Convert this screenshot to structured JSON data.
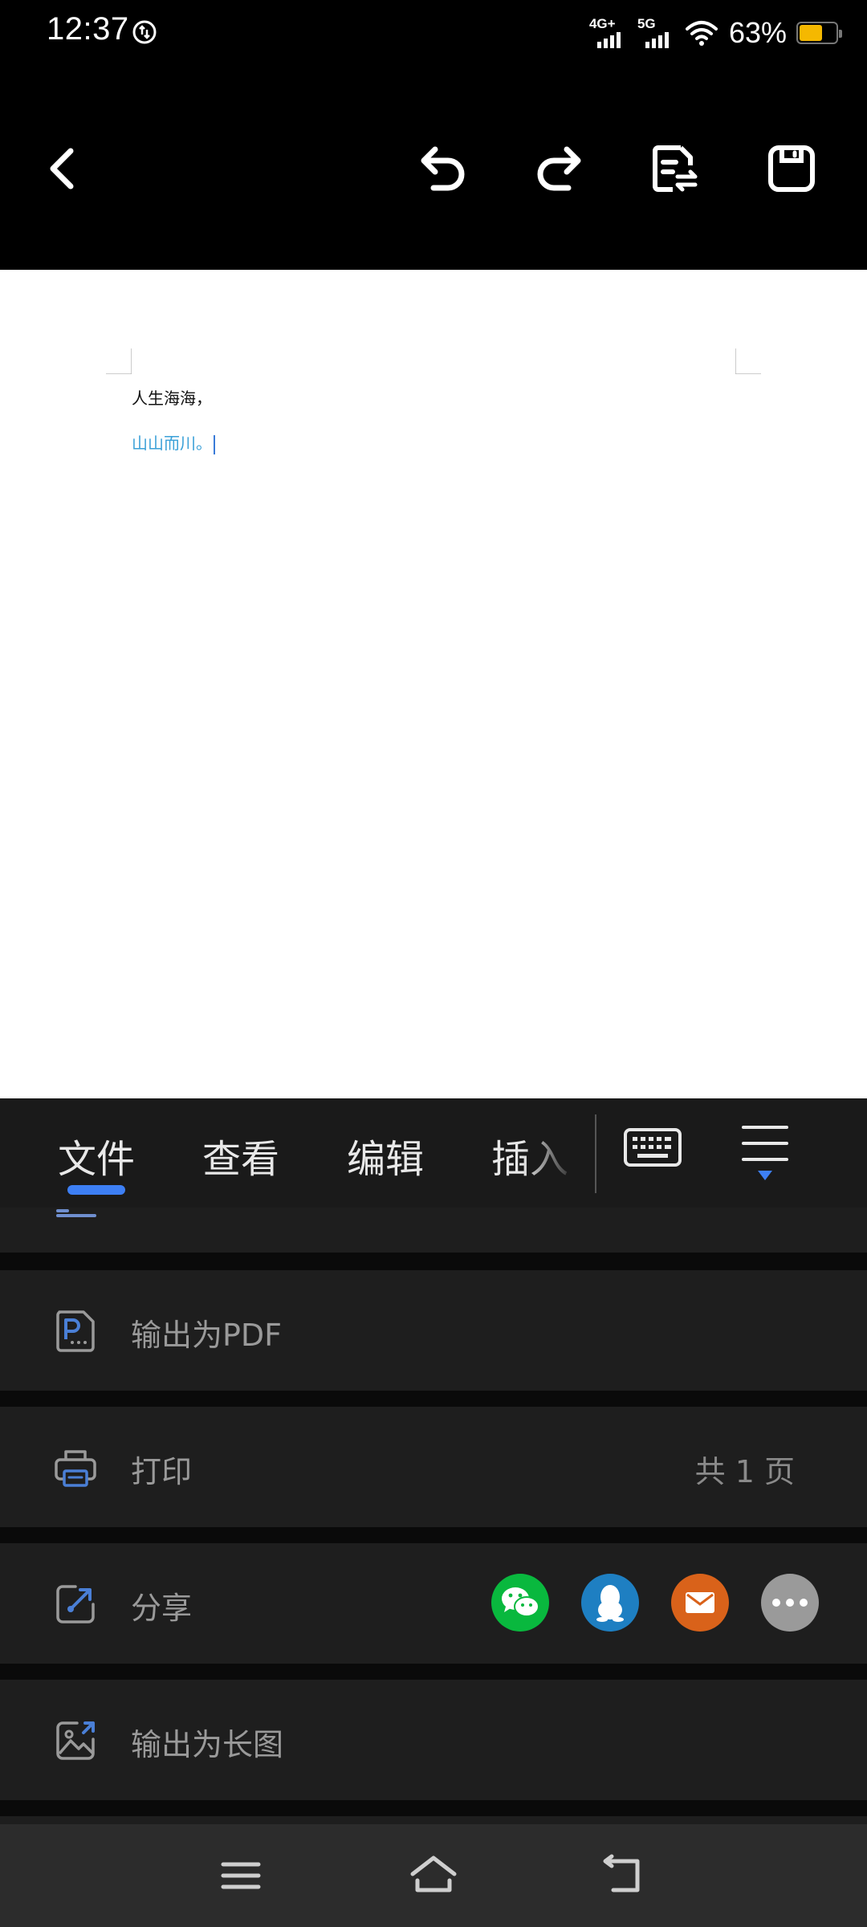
{
  "status_bar": {
    "time": "12:37",
    "network1": "4G+",
    "network2": "5G",
    "battery_percent": "63%",
    "battery_level": 0.63,
    "icons": [
      "vpn-icon",
      "signal-icon",
      "wifi-icon",
      "battery-icon"
    ]
  },
  "toolbar": {
    "icons": [
      "back-icon",
      "undo-icon",
      "redo-icon",
      "document-switch-icon",
      "save-icon"
    ]
  },
  "document": {
    "line1": "人生海海，",
    "line2": "山山而川。",
    "line2_color": "#3aa0d8"
  },
  "tabs": {
    "items": [
      {
        "label": "文件"
      },
      {
        "label": "查看"
      },
      {
        "label": "编辑"
      },
      {
        "label": "插入"
      }
    ],
    "active_index": 0,
    "accent": "#3d7ff5",
    "icons": [
      "keyboard-icon",
      "menu-icon"
    ]
  },
  "menu": {
    "items": [
      {
        "label": "输出为PDF",
        "icon": "pdf-icon"
      },
      {
        "label": "打印",
        "icon": "printer-icon",
        "right_text": "共 1 页"
      },
      {
        "label": "分享",
        "icon": "share-icon"
      },
      {
        "label": "输出为长图",
        "icon": "image-export-icon"
      }
    ],
    "share_targets": [
      {
        "name": "wechat-icon",
        "color": "#09b83e"
      },
      {
        "name": "qq-icon",
        "color": "#1e7fc2"
      },
      {
        "name": "mail-icon",
        "color": "#d9621a"
      },
      {
        "name": "more-icon",
        "color": "#9a9a9a"
      }
    ]
  },
  "system_nav": {
    "icons": [
      "recents-icon",
      "home-icon",
      "back-nav-icon"
    ]
  }
}
